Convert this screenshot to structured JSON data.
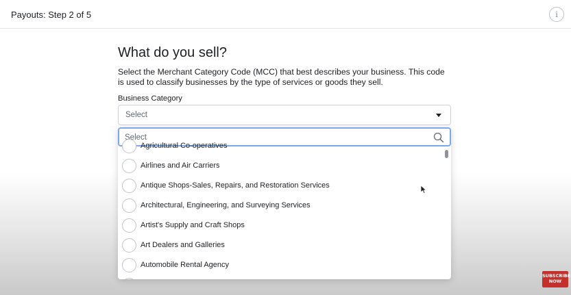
{
  "header": {
    "title": "Payouts: Step 2 of 5",
    "info_icon": "info-icon",
    "info_glyph": "i"
  },
  "main": {
    "heading": "What do you sell?",
    "description": "Select the Merchant Category Code (MCC) that best describes your business. This code is used to classify businesses by the type of services or goods they sell.",
    "field_label": "Business Category",
    "select_value": "Select",
    "caret_icon": "caret-down-icon"
  },
  "dropdown": {
    "search_placeholder": "Select",
    "search_icon": "search-icon",
    "items": [
      {
        "label": "Agricultural Co-operatives"
      },
      {
        "label": "Airlines and Air Carriers"
      },
      {
        "label": "Antique Shops-Sales, Repairs, and Restoration Services"
      },
      {
        "label": "Architectural, Engineering, and Surveying Services"
      },
      {
        "label": "Artist's Supply and Craft Shops"
      },
      {
        "label": "Art Dealers and Galleries"
      },
      {
        "label": "Automobile Rental Agency"
      }
    ]
  },
  "overlay": {
    "subscribe_line1": "SUBSCRIBE",
    "subscribe_line2": "NOW"
  },
  "colors": {
    "focus_border": "#7aa8e8",
    "subscribe_red": "#c4302b",
    "text": "#1c1e21"
  }
}
